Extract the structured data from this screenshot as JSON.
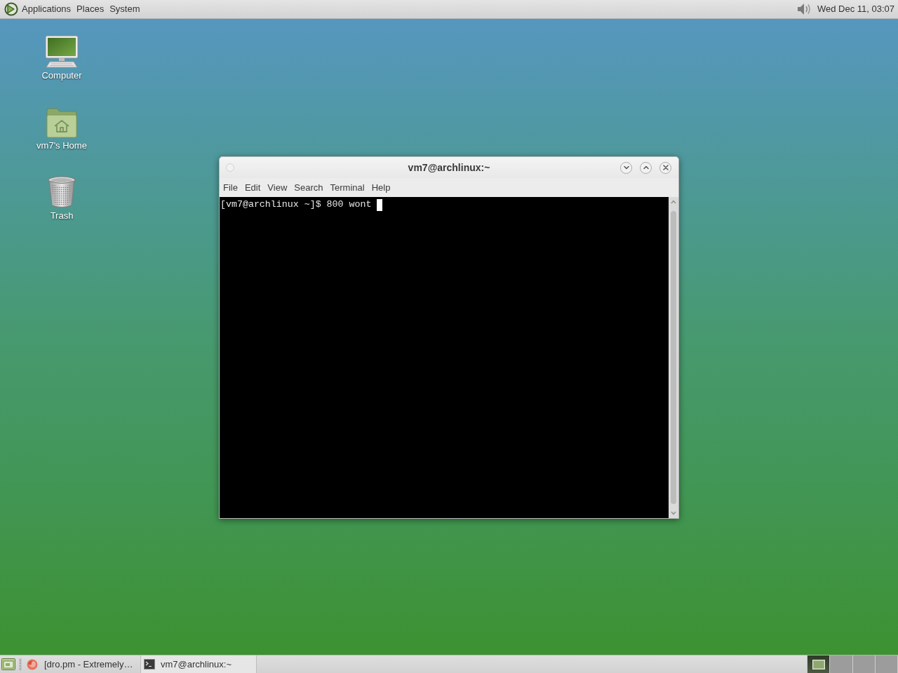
{
  "top_panel": {
    "menus": [
      "Applications",
      "Places",
      "System"
    ],
    "clock": "Wed Dec 11, 03:07"
  },
  "desktop_icons": [
    {
      "kind": "computer",
      "label": "Computer"
    },
    {
      "kind": "home",
      "label": "vm7's Home"
    },
    {
      "kind": "trash",
      "label": "Trash"
    }
  ],
  "terminal_window": {
    "title": "vm7@archlinux:~",
    "menus": [
      "File",
      "Edit",
      "View",
      "Search",
      "Terminal",
      "Help"
    ],
    "lines": [
      "[vm7@archlinux ~]$ 800 wont"
    ]
  },
  "taskbar": {
    "tasks": [
      {
        "kind": "browser",
        "label": "[dro.pm - Extremely…",
        "selected": false
      },
      {
        "kind": "terminal",
        "label": "vm7@archlinux:~",
        "selected": true
      }
    ],
    "workspaces": [
      {
        "selected": true
      },
      {
        "selected": false
      },
      {
        "selected": false
      },
      {
        "selected": false
      }
    ]
  }
}
